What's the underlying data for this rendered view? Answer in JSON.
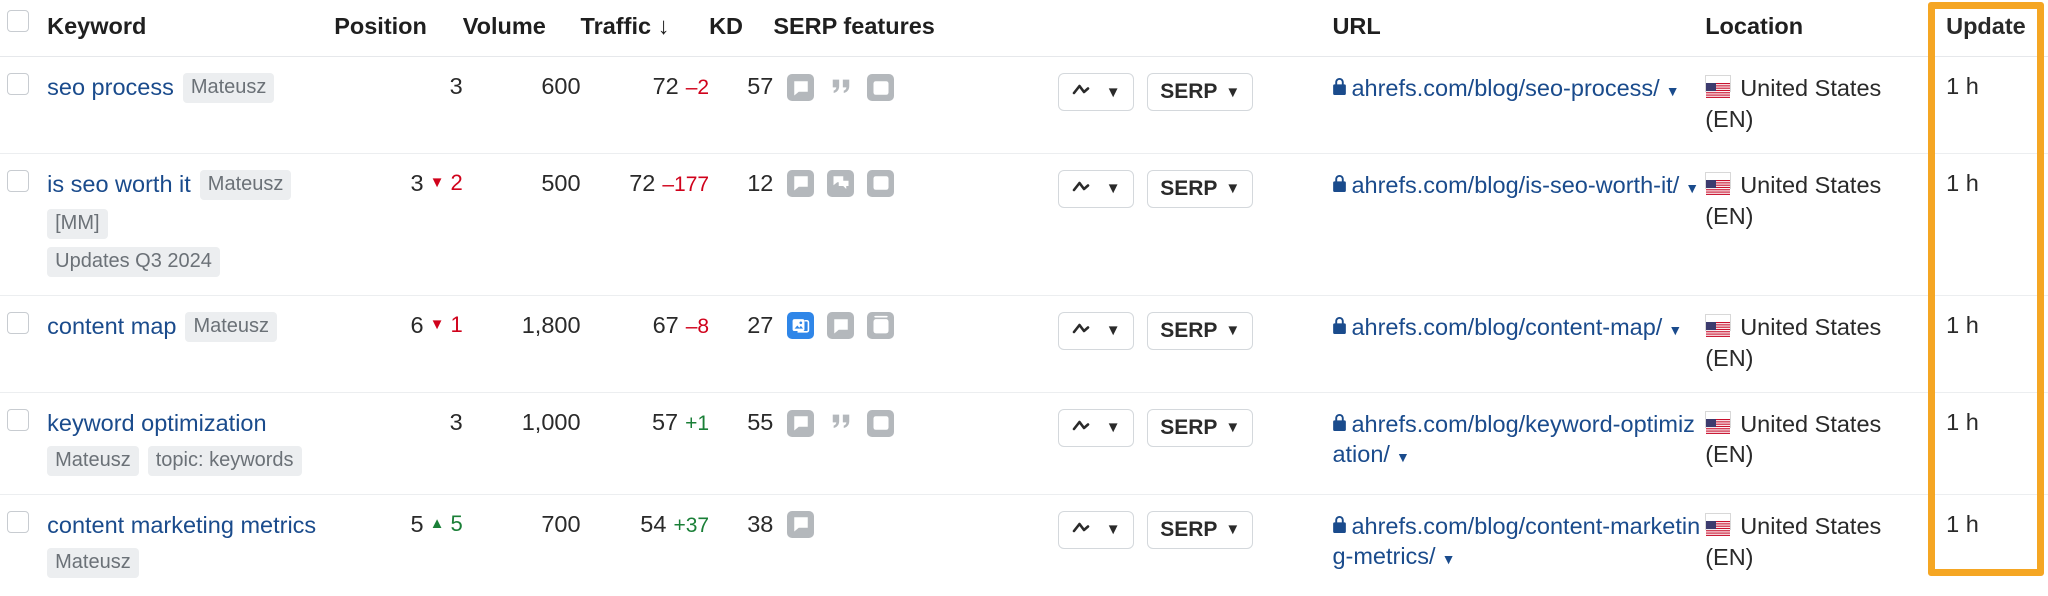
{
  "table": {
    "columns": [
      {
        "key": "check",
        "label": ""
      },
      {
        "key": "keyword",
        "label": "Keyword"
      },
      {
        "key": "pos",
        "label": "Position"
      },
      {
        "key": "vol",
        "label": "Volume"
      },
      {
        "key": "traffic",
        "label": "Traffic ↓"
      },
      {
        "key": "kd",
        "label": "KD"
      },
      {
        "key": "serpf",
        "label": "SERP features"
      },
      {
        "key": "actions",
        "label": ""
      },
      {
        "key": "url",
        "label": "URL"
      },
      {
        "key": "loc",
        "label": "Location"
      },
      {
        "key": "update",
        "label": "Update"
      }
    ],
    "buttons": {
      "chart_label": "",
      "serp_label": "SERP",
      "caret": "▼"
    },
    "highlight_color": "#f5a623",
    "rows": [
      {
        "keyword": "seo process",
        "tags_inline": [
          "Mateusz"
        ],
        "tags_below": [],
        "position": "3",
        "position_delta": "",
        "position_dir": "none",
        "volume": "600",
        "traffic": "72",
        "traffic_delta": "–2",
        "traffic_dir": "down",
        "kd": "57",
        "serp_features": [
          "faq-icon",
          "quotes-icon",
          "video-icon"
        ],
        "serp_features_active": [],
        "url": "ahrefs.com/blog/seo-process/",
        "location": "United States (EN)",
        "location_flag": "us-flag",
        "update": "1 h"
      },
      {
        "keyword": "is seo worth it",
        "tags_inline": [
          "Mateusz",
          "[MM]"
        ],
        "tags_below": [
          "Updates Q3 2024"
        ],
        "position": "3",
        "position_delta": "2",
        "position_dir": "down",
        "volume": "500",
        "traffic": "72",
        "traffic_delta": "–177",
        "traffic_dir": "down",
        "kd": "12",
        "serp_features": [
          "faq-icon",
          "discussions-icon",
          "video-icon"
        ],
        "serp_features_active": [],
        "url": "ahrefs.com/blog/is-seo-worth-it/",
        "location": "United States (EN)",
        "location_flag": "us-flag",
        "update": "1 h"
      },
      {
        "keyword": "content map",
        "tags_inline": [
          "Mateusz"
        ],
        "tags_below": [],
        "position": "6",
        "position_delta": "1",
        "position_dir": "down",
        "volume": "1,800",
        "traffic": "67",
        "traffic_delta": "–8",
        "traffic_dir": "down",
        "kd": "27",
        "serp_features": [
          "image-pack-icon",
          "faq-icon",
          "video-carousel-icon"
        ],
        "serp_features_active": [
          "image-pack-icon"
        ],
        "url": "ahrefs.com/blog/content-map/",
        "location": "United States (EN)",
        "location_flag": "us-flag",
        "update": "1 h"
      },
      {
        "keyword": "keyword optimization",
        "tags_inline": [],
        "tags_below": [
          "Mateusz",
          "topic: keywords"
        ],
        "position": "3",
        "position_delta": "",
        "position_dir": "none",
        "volume": "1,000",
        "traffic": "57",
        "traffic_delta": "+1",
        "traffic_dir": "up",
        "kd": "55",
        "serp_features": [
          "faq-icon",
          "quotes-icon",
          "video-icon"
        ],
        "serp_features_active": [],
        "url": "ahrefs.com/blog/keyword-optimization/",
        "location": "United States (EN)",
        "location_flag": "us-flag",
        "update": "1 h"
      },
      {
        "keyword": "content marketing metrics",
        "tags_inline": [],
        "tags_below": [
          "Mateusz"
        ],
        "position": "5",
        "position_delta": "5",
        "position_dir": "up",
        "volume": "700",
        "traffic": "54",
        "traffic_delta": "+37",
        "traffic_dir": "up",
        "kd": "38",
        "serp_features": [
          "faq-icon"
        ],
        "serp_features_active": [],
        "url": "ahrefs.com/blog/content-marketing-metrics/",
        "location": "United States (EN)",
        "location_flag": "us-flag",
        "update": "1 h"
      }
    ]
  }
}
